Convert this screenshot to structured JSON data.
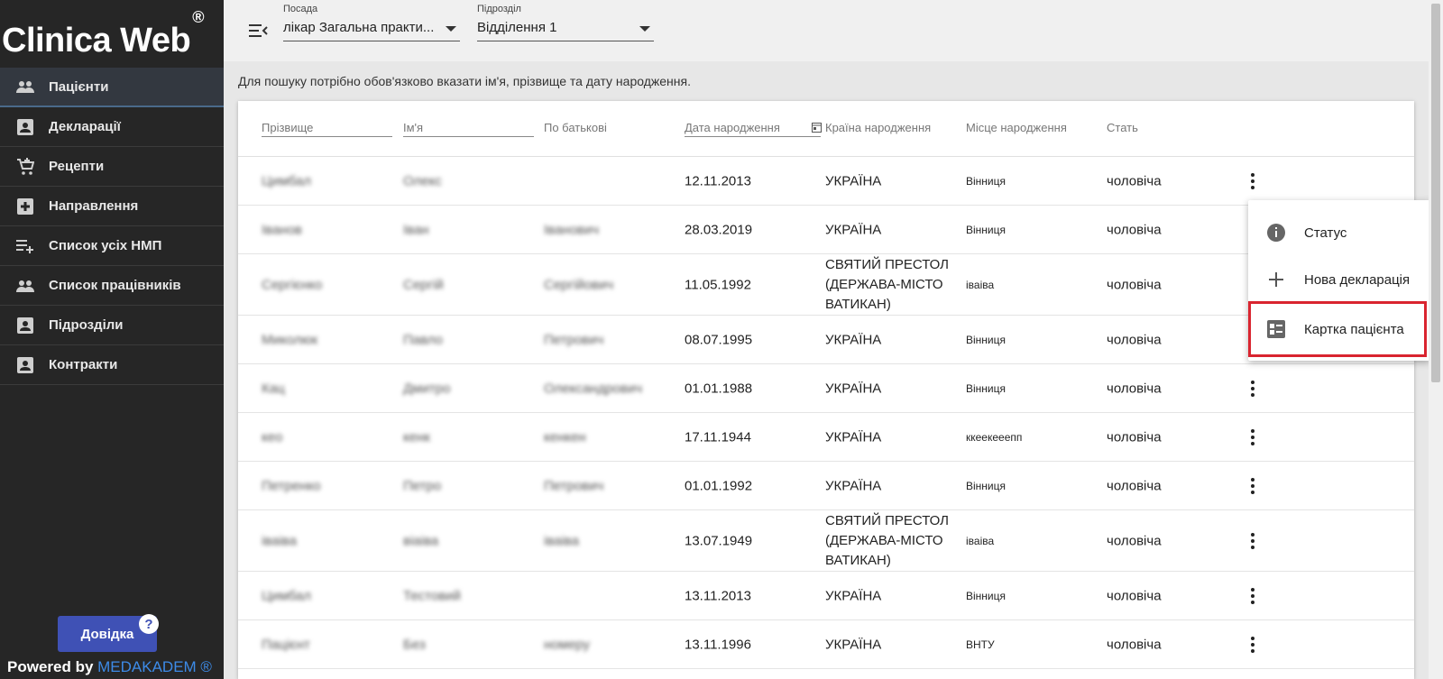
{
  "app": {
    "logo": "Clinica Web",
    "logo_mark": "®"
  },
  "sidebar": {
    "items": [
      {
        "label": "Пацієнти",
        "icon": "people-icon",
        "active": true
      },
      {
        "label": "Декларації",
        "icon": "contact-card-icon"
      },
      {
        "label": "Рецепти",
        "icon": "cart-add-icon"
      },
      {
        "label": "Направлення",
        "icon": "medical-cross-icon"
      },
      {
        "label": "Список усіх НМП",
        "icon": "playlist-add-icon"
      },
      {
        "label": "Список працівників",
        "icon": "people-icon"
      },
      {
        "label": "Підрозділи",
        "icon": "contact-card-icon"
      },
      {
        "label": "Контракти",
        "icon": "contact-card-icon"
      }
    ],
    "help_label": "Довідка",
    "help_badge": "?",
    "powered_prefix": "Powered by ",
    "powered_brand": "MEDAKADEM ®"
  },
  "topbar": {
    "position": {
      "caption": "Посада",
      "value": "лікар Загальна практи..."
    },
    "department": {
      "caption": "Підрозділ",
      "value": "Відділення 1"
    }
  },
  "hint": "Для пошуку потрібно обов'язково вказати ім'я, прізвище та дату народження.",
  "table": {
    "headers": {
      "surname": "Прізвище",
      "name": "Ім'я",
      "patronymic": "По батькові",
      "birth_date": "Дата народження",
      "country": "Країна народження",
      "place": "Місце народження",
      "sex": "Стать"
    },
    "rows": [
      {
        "surname": "Цимбал",
        "name": "Олекс",
        "patronymic": "",
        "birth_date": "12.11.2013",
        "country": "УКРАЇНА",
        "place": "Вінниця",
        "sex": "чоловіча"
      },
      {
        "surname": "Іванов",
        "name": "Іван",
        "patronymic": "Іванович",
        "birth_date": "28.03.2019",
        "country": "УКРАЇНА",
        "place": "Вінниця",
        "sex": "чоловіча"
      },
      {
        "surname": "Сергієнко",
        "name": "Сергій",
        "patronymic": "Сергійович",
        "birth_date": "11.05.1992",
        "country": "СВЯТИЙ ПРЕСТОЛ (ДЕРЖАВА-МІСТО ВАТИКАН)",
        "place": "іваіва",
        "sex": "чоловіча"
      },
      {
        "surname": "Миколюк",
        "name": "Павло",
        "patronymic": "Петрович",
        "birth_date": "08.07.1995",
        "country": "УКРАЇНА",
        "place": "Вінниця",
        "sex": "чоловіча"
      },
      {
        "surname": "Кац",
        "name": "Дмитро",
        "patronymic": "Олександрович",
        "birth_date": "01.01.1988",
        "country": "УКРАЇНА",
        "place": "Вінниця",
        "sex": "чоловіча"
      },
      {
        "surname": "кео",
        "name": "кенк",
        "patronymic": "кенкен",
        "birth_date": "17.11.1944",
        "country": "УКРАЇНА",
        "place": "ккеекееепп",
        "sex": "чоловіча"
      },
      {
        "surname": "Петренко",
        "name": "Петро",
        "patronymic": "Петрович",
        "birth_date": "01.01.1992",
        "country": "УКРАЇНА",
        "place": "Вінниця",
        "sex": "чоловіча"
      },
      {
        "surname": "іваіва",
        "name": "віаіва",
        "patronymic": "іваіва",
        "birth_date": "13.07.1949",
        "country": "СВЯТИЙ ПРЕСТОЛ (ДЕРЖАВА-МІСТО ВАТИКАН)",
        "place": "іваіва",
        "sex": "чоловіча"
      },
      {
        "surname": "Цимбал",
        "name": "Тестовий",
        "patronymic": "",
        "birth_date": "13.11.2013",
        "country": "УКРАЇНА",
        "place": "Вінниця",
        "sex": "чоловіча"
      },
      {
        "surname": "Пацієнт",
        "name": "Без",
        "patronymic": "номеру",
        "birth_date": "13.11.1996",
        "country": "УКРАЇНА",
        "place": "ВНТУ",
        "sex": "чоловіча"
      }
    ]
  },
  "context_menu": {
    "items": [
      {
        "label": "Статус",
        "icon": "info-icon"
      },
      {
        "label": "Нова декларація",
        "icon": "plus-icon"
      },
      {
        "label": "Картка пацієнта",
        "icon": "patient-card-icon",
        "highlighted": true
      }
    ]
  },
  "colors": {
    "sidebar_bg": "#262626",
    "accent": "#3f51b5",
    "highlight": "#d9242f",
    "brand": "#3d8be8"
  }
}
